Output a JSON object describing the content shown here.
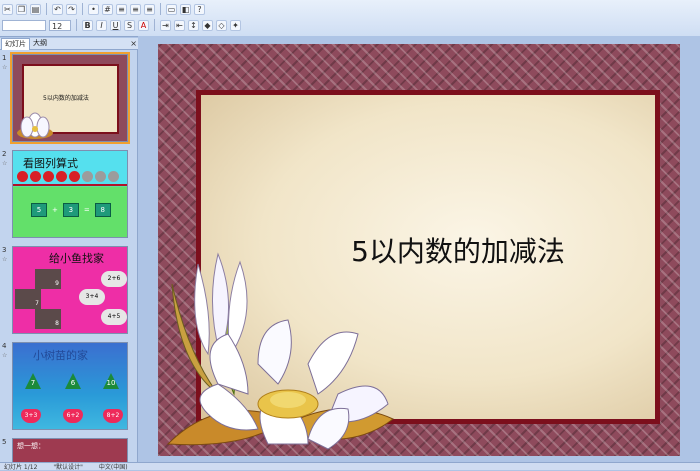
{
  "ribbon": {
    "font_name": "",
    "font_size": "12",
    "row1_icons": [
      "cut-icon",
      "copy-icon",
      "paste-icon",
      "undo-icon",
      "redo-icon",
      "bullet-list-icon",
      "numbered-list-icon",
      "align-left-icon",
      "align-center-icon",
      "align-right-icon",
      "shape-icon",
      "arrange-icon",
      "help-icon"
    ],
    "row2_labels": [
      "B",
      "I",
      "U",
      "S",
      "A"
    ]
  },
  "panel": {
    "tab_slides": "幻灯片",
    "tab_outline": "大纲",
    "close_glyph": "×"
  },
  "thumbnails": [
    {
      "number": "1",
      "title": "5以内数的加减法"
    },
    {
      "number": "2",
      "title": "看图列算式",
      "eq_a": "5",
      "eq_op": "+",
      "eq_b": "3",
      "eq_eq": "=",
      "eq_c": "8"
    },
    {
      "number": "3",
      "title": "给小鱼找家",
      "items": [
        "2+6",
        "3+4",
        "4+5",
        "9",
        "7",
        "8"
      ]
    },
    {
      "number": "4",
      "title": "小树苗的家",
      "trees": [
        "7",
        "6",
        "10"
      ],
      "hearts": [
        "3+3",
        "6+2",
        "8+2"
      ]
    },
    {
      "number": "5",
      "title": "想一想："
    }
  ],
  "slide": {
    "title": "5以内数的加减法"
  },
  "status": {
    "slide_info": "幻灯片 1/12",
    "theme": "\"默认设计\"",
    "language": "中文(中国)"
  },
  "colors": {
    "frame": "#8e4a5c",
    "border": "#7c0f1c",
    "parchment": "#f1e5c8"
  }
}
